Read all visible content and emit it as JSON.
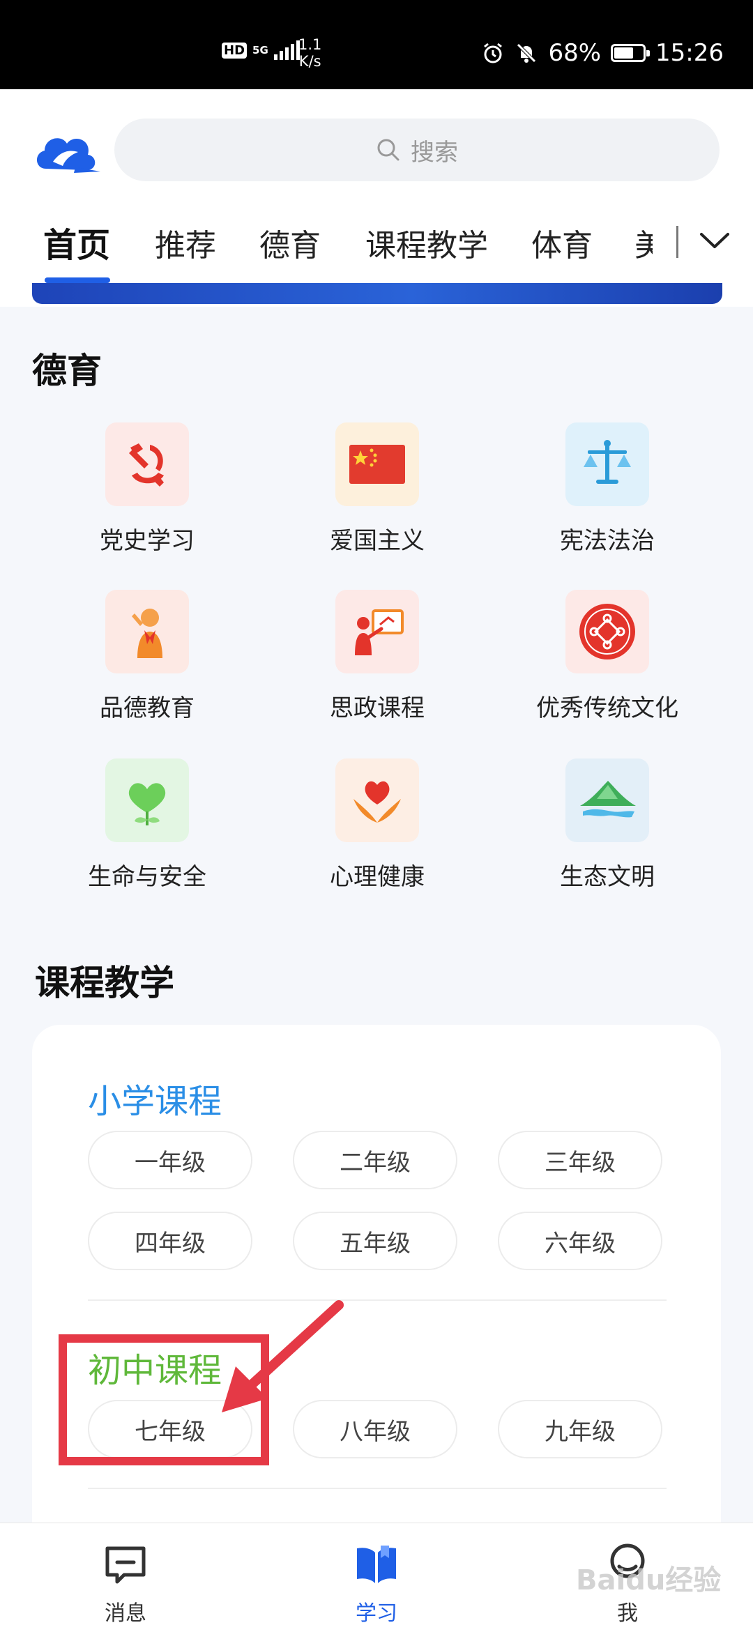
{
  "status_bar": {
    "network_hd": "HD",
    "network_type": "5G",
    "speed_value": "1.1",
    "speed_unit": "K/s",
    "battery_percent": "68%",
    "battery_level": 0.68,
    "time": "15:26"
  },
  "header": {
    "search_placeholder": "搜索",
    "tabs": [
      "首页",
      "推荐",
      "德育",
      "课程教学",
      "体育",
      "美"
    ],
    "active_tab": 0
  },
  "moral": {
    "title": "德育",
    "items": [
      {
        "label": "党史学习",
        "icon": "party-emblem-icon"
      },
      {
        "label": "爱国主义",
        "icon": "national-flag-icon"
      },
      {
        "label": "宪法法治",
        "icon": "scales-icon"
      },
      {
        "label": "品德教育",
        "icon": "saluting-pioneer-icon"
      },
      {
        "label": "思政课程",
        "icon": "teacher-board-icon"
      },
      {
        "label": "优秀传统文化",
        "icon": "chinese-knot-icon"
      },
      {
        "label": "生命与安全",
        "icon": "green-heart-sprout-icon"
      },
      {
        "label": "心理健康",
        "icon": "heart-hands-icon"
      },
      {
        "label": "生态文明",
        "icon": "mountain-landscape-icon"
      }
    ]
  },
  "courses": {
    "title": "课程教学",
    "primary": {
      "title": "小学课程",
      "grades": [
        "一年级",
        "二年级",
        "三年级",
        "四年级",
        "五年级",
        "六年级"
      ]
    },
    "junior": {
      "title": "初中课程",
      "grades": [
        "七年级",
        "八年级",
        "九年级"
      ]
    }
  },
  "bottom_nav": {
    "items": [
      {
        "label": "消息",
        "icon": "message-icon"
      },
      {
        "label": "学习",
        "icon": "book-icon"
      },
      {
        "label": "我",
        "icon": "profile-icon"
      }
    ],
    "active": 1
  },
  "watermark": "Baidu经验",
  "colors": {
    "accent": "#1f5fe6",
    "primary_course": "#2a8ee6",
    "junior_course": "#5fb83a",
    "annotation": "#e53946"
  }
}
